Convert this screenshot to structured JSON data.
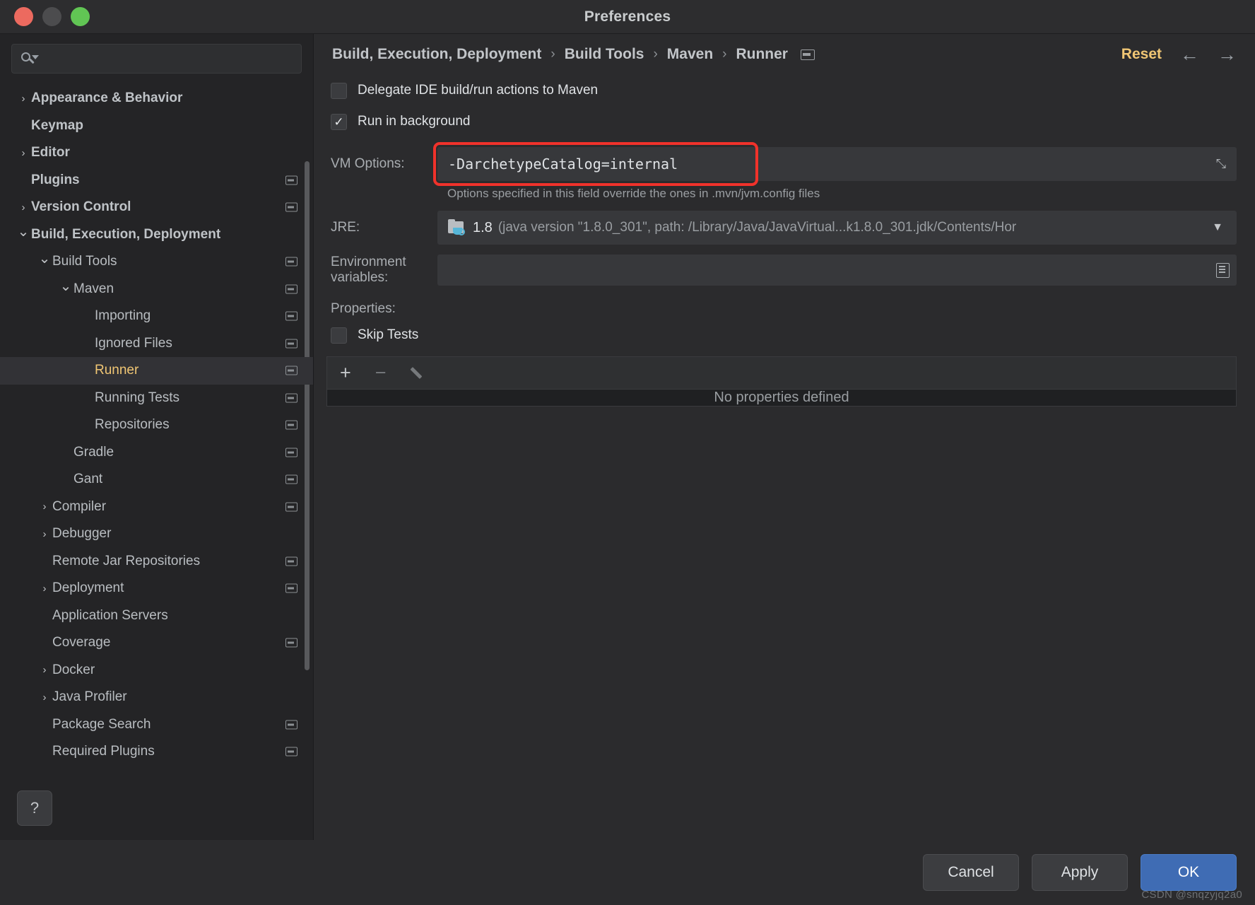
{
  "window": {
    "title": "Preferences",
    "traffic_lights": [
      "close-button",
      "minimize-button",
      "maximize-button"
    ]
  },
  "sidebar": {
    "search": {
      "value": "",
      "placeholder": "",
      "icon": "search-icon"
    },
    "help_button": "?",
    "items": [
      {
        "label": "Appearance & Behavior",
        "level": 0,
        "arrow": "›",
        "badge": false,
        "selected": false
      },
      {
        "label": "Keymap",
        "level": 0,
        "arrow": "",
        "badge": false,
        "selected": false
      },
      {
        "label": "Editor",
        "level": 0,
        "arrow": "›",
        "badge": false,
        "selected": false
      },
      {
        "label": "Plugins",
        "level": 0,
        "arrow": "",
        "badge": true,
        "selected": false
      },
      {
        "label": "Version Control",
        "level": 0,
        "arrow": "›",
        "badge": true,
        "selected": false
      },
      {
        "label": "Build, Execution, Deployment",
        "level": 0,
        "arrow": "⌄",
        "badge": false,
        "selected": false
      },
      {
        "label": "Build Tools",
        "level": 1,
        "arrow": "⌄",
        "badge": true,
        "selected": false
      },
      {
        "label": "Maven",
        "level": 2,
        "arrow": "⌄",
        "badge": true,
        "selected": false
      },
      {
        "label": "Importing",
        "level": 3,
        "arrow": "",
        "badge": true,
        "selected": false
      },
      {
        "label": "Ignored Files",
        "level": 3,
        "arrow": "",
        "badge": true,
        "selected": false
      },
      {
        "label": "Runner",
        "level": 3,
        "arrow": "",
        "badge": true,
        "selected": true
      },
      {
        "label": "Running Tests",
        "level": 3,
        "arrow": "",
        "badge": true,
        "selected": false
      },
      {
        "label": "Repositories",
        "level": 3,
        "arrow": "",
        "badge": true,
        "selected": false
      },
      {
        "label": "Gradle",
        "level": 2,
        "arrow": "",
        "badge": true,
        "selected": false
      },
      {
        "label": "Gant",
        "level": 2,
        "arrow": "",
        "badge": true,
        "selected": false
      },
      {
        "label": "Compiler",
        "level": 1,
        "arrow": "›",
        "badge": true,
        "selected": false
      },
      {
        "label": "Debugger",
        "level": 1,
        "arrow": "›",
        "badge": false,
        "selected": false
      },
      {
        "label": "Remote Jar Repositories",
        "level": 1,
        "arrow": "",
        "badge": true,
        "selected": false
      },
      {
        "label": "Deployment",
        "level": 1,
        "arrow": "›",
        "badge": true,
        "selected": false
      },
      {
        "label": "Application Servers",
        "level": 1,
        "arrow": "",
        "badge": false,
        "selected": false
      },
      {
        "label": "Coverage",
        "level": 1,
        "arrow": "",
        "badge": true,
        "selected": false
      },
      {
        "label": "Docker",
        "level": 1,
        "arrow": "›",
        "badge": false,
        "selected": false
      },
      {
        "label": "Java Profiler",
        "level": 1,
        "arrow": "›",
        "badge": false,
        "selected": false
      },
      {
        "label": "Package Search",
        "level": 1,
        "arrow": "",
        "badge": true,
        "selected": false
      },
      {
        "label": "Required Plugins",
        "level": 1,
        "arrow": "",
        "badge": true,
        "selected": false
      }
    ]
  },
  "breadcrumb": {
    "parts": [
      "Build, Execution, Deployment",
      "Build Tools",
      "Maven",
      "Runner"
    ],
    "separator": "›",
    "scope_icon": "project-scope-icon"
  },
  "toolbar": {
    "reset_label": "Reset",
    "back_arrow": "←",
    "forward_arrow": "→",
    "reset_color": "#f0c674"
  },
  "form": {
    "delegate": {
      "label": "Delegate IDE build/run actions to Maven",
      "checked": false,
      "mark": ""
    },
    "run_background": {
      "label": "Run in background",
      "checked": true,
      "mark": "✓"
    },
    "vm_options": {
      "label": "VM Options:",
      "value": "-DarchetypeCatalog=internal",
      "expand_icon": "⤡",
      "hint": "Options specified in this field override the ones in .mvn/jvm.config files",
      "highlight_color": "#f0322b"
    },
    "jre": {
      "label": "JRE:",
      "version": "1.8",
      "description": "(java version \"1.8.0_301\", path: /Library/Java/JavaVirtual...k1.8.0_301.jdk/Contents/Hor",
      "icon": "java-folder-icon",
      "dropdown_arrow": "▼"
    },
    "env_vars": {
      "label": "Environment variables:",
      "value": "",
      "icon": "edit-list-icon"
    },
    "properties": {
      "label": "Properties:",
      "skip_tests": {
        "label": "Skip Tests",
        "checked": false,
        "mark": ""
      },
      "add_icon": "+",
      "remove_icon": "−",
      "edit_icon": "pencil-icon",
      "empty_text": "No properties defined"
    }
  },
  "footer": {
    "cancel": "Cancel",
    "apply": "Apply",
    "ok": "OK",
    "watermark": "CSDN @snqzyjq2a0"
  }
}
